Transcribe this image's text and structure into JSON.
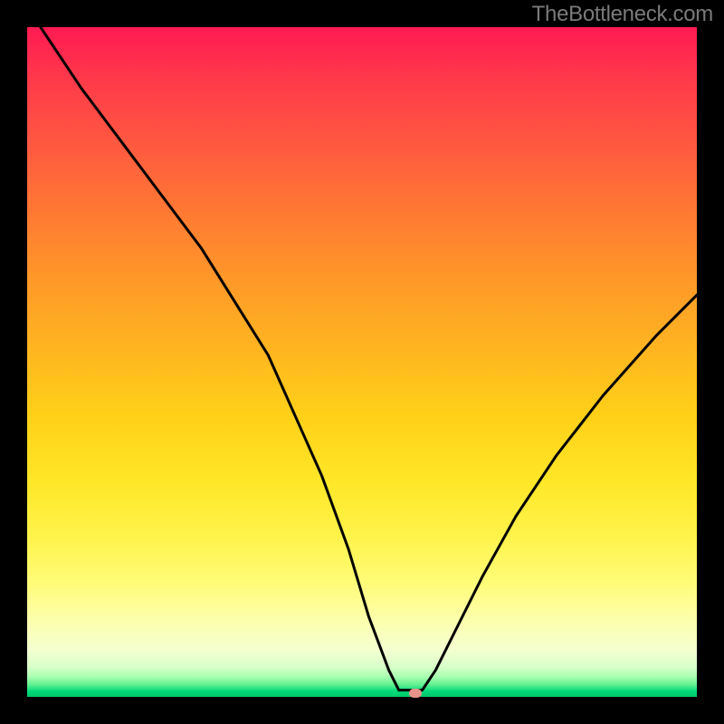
{
  "watermark": "TheBottleneck.com",
  "marker": {
    "x_pct": 58,
    "y_pct": 99.5
  },
  "chart_data": {
    "type": "line",
    "title": "",
    "xlabel": "",
    "ylabel": "",
    "xlim": [
      0,
      100
    ],
    "ylim": [
      0,
      100
    ],
    "series": [
      {
        "name": "bottleneck-curve",
        "x": [
          2,
          8,
          14,
          20,
          26,
          31,
          36,
          40,
          44,
          48,
          51,
          54,
          55.5,
          57,
          59,
          61,
          64,
          68,
          73,
          79,
          86,
          94,
          100
        ],
        "y": [
          100,
          91,
          83,
          75,
          67,
          59,
          51,
          42,
          33,
          22,
          12,
          4,
          1,
          1,
          1,
          4,
          10,
          18,
          27,
          36,
          45,
          54,
          60
        ]
      }
    ],
    "gradient_bands": [
      {
        "stop_pct": 0,
        "color": "#ff1a52"
      },
      {
        "stop_pct": 8,
        "color": "#ff3a4a"
      },
      {
        "stop_pct": 18,
        "color": "#ff5a40"
      },
      {
        "stop_pct": 28,
        "color": "#ff7a32"
      },
      {
        "stop_pct": 38,
        "color": "#ff9928"
      },
      {
        "stop_pct": 48,
        "color": "#ffb520"
      },
      {
        "stop_pct": 58,
        "color": "#ffd018"
      },
      {
        "stop_pct": 68,
        "color": "#ffe728"
      },
      {
        "stop_pct": 76,
        "color": "#fff34a"
      },
      {
        "stop_pct": 83,
        "color": "#fffc78"
      },
      {
        "stop_pct": 89,
        "color": "#fcffb0"
      },
      {
        "stop_pct": 93,
        "color": "#f4ffd0"
      },
      {
        "stop_pct": 95.5,
        "color": "#d8ffca"
      },
      {
        "stop_pct": 97,
        "color": "#a8ffb0"
      },
      {
        "stop_pct": 98.2,
        "color": "#60f090"
      },
      {
        "stop_pct": 99.2,
        "color": "#00d878"
      },
      {
        "stop_pct": 100,
        "color": "#00c86a"
      }
    ],
    "marker": {
      "x": 58,
      "y": 0.5,
      "color": "#e8938a"
    }
  }
}
